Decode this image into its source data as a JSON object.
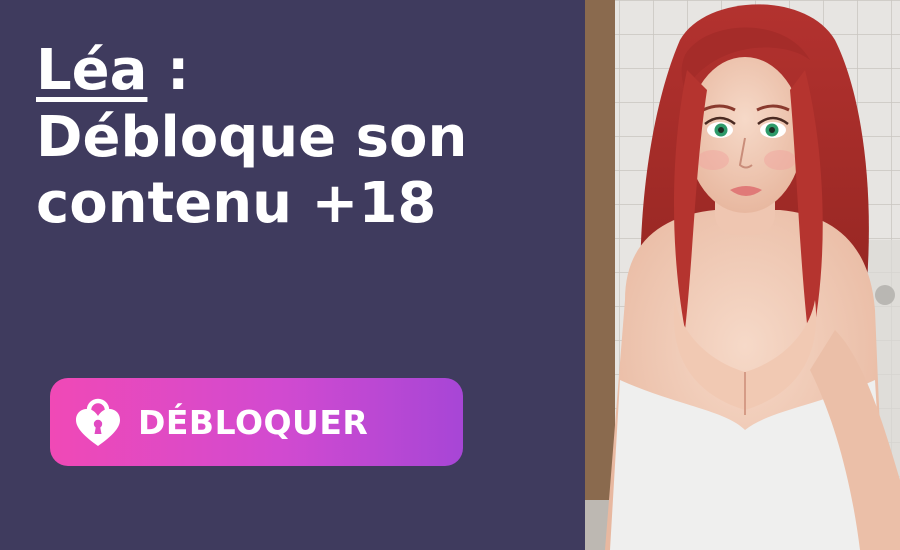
{
  "banner": {
    "name": "Léa",
    "name_suffix": " :",
    "headline_rest": "Débloque son contenu +18",
    "button_label": "DÉBLOQUER"
  },
  "icons": {
    "button_icon": "heart-lock-icon"
  },
  "colors": {
    "background": "#3f3b5e",
    "button_gradient_start": "#f049b6",
    "button_gradient_end": "#a746d6",
    "text": "#ffffff"
  }
}
